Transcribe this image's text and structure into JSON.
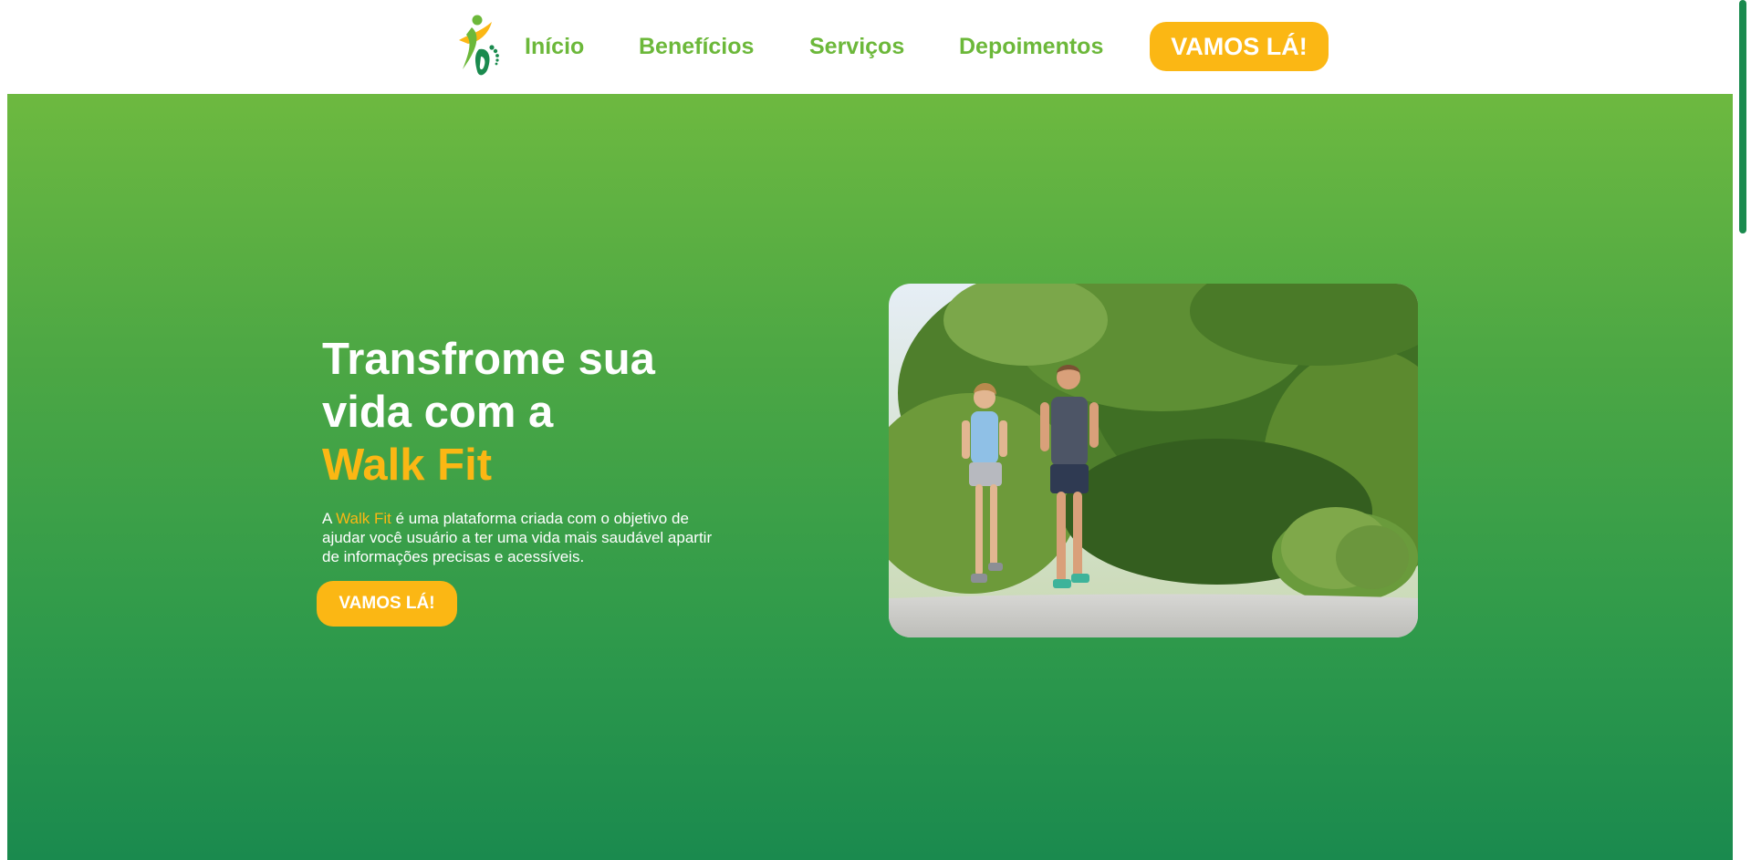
{
  "header": {
    "nav": {
      "inicio": "Início",
      "beneficios": "Benefícios",
      "servicos": "Serviços",
      "depoimentos": "Depoimentos"
    },
    "cta_label": "VAMOS LÁ!",
    "logo_icon": "walk-fit-logo-icon"
  },
  "hero": {
    "title_line1": "Transfrome sua",
    "title_line2": "vida com a",
    "title_accent": "Walk Fit",
    "desc_prefix": "A ",
    "desc_brand": "Walk Fit",
    "desc_rest": " é uma plataforma criada com o objetivo de ajudar você usuário a ter uma vida mais saudável apartir de informações precisas e acessíveis.",
    "cta_label": "VAMOS LÁ!",
    "photo_icon": "runners-photo"
  },
  "colors": {
    "brand_green": "#6cb83a",
    "dark_green": "#1a8a4e",
    "accent_yellow": "#fbb714",
    "white": "#ffffff"
  }
}
